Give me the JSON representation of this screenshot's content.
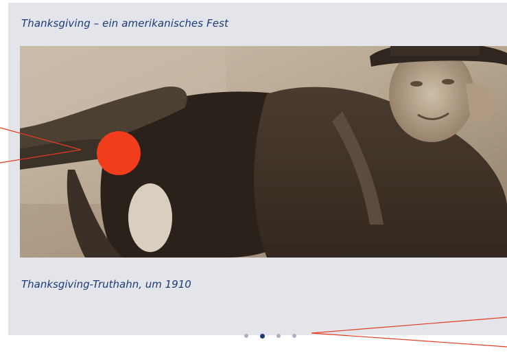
{
  "card": {
    "title": "Thanksgiving – ein amerikanisches Fest",
    "caption": "Thanksgiving-Truthahn, um 1910"
  },
  "image": {
    "subject": "sepia photograph of a young man carrying a turkey on his back"
  },
  "carousel": {
    "total_slides": 4,
    "active_index": 2,
    "dots": [
      {
        "state": "inactive"
      },
      {
        "state": "active"
      },
      {
        "state": "inactive"
      },
      {
        "state": "inactive"
      }
    ]
  },
  "annotation": {
    "marker_color": "#f13d1c",
    "line_color": "#e43b22"
  },
  "colors": {
    "accent": "#1c3a78",
    "card_bg": "#e3e5ea",
    "dot_inactive": "#a9b1c3"
  }
}
